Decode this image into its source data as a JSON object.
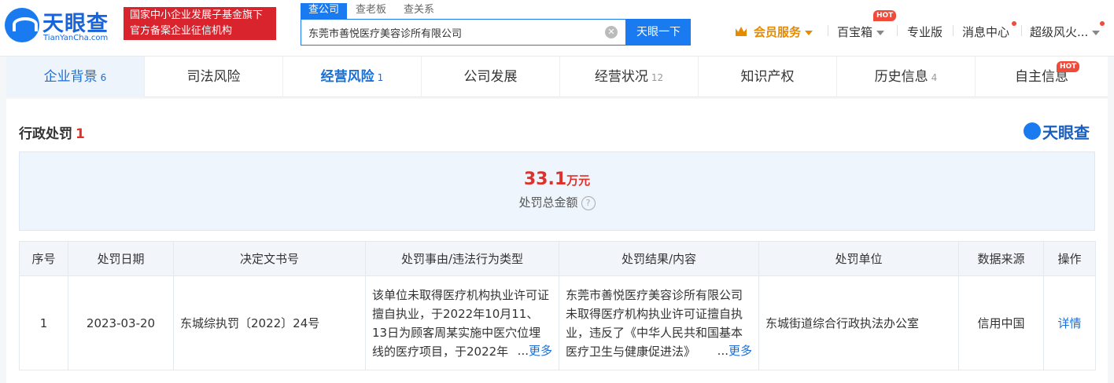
{
  "header": {
    "logo_title": "天眼查",
    "logo_sub": "TianYanCha.com",
    "banner_line1": "国家中小企业发展子基金旗下",
    "banner_line2": "官方备案企业征信机构",
    "search_tabs": [
      "查公司",
      "查老板",
      "查关系"
    ],
    "search_value": "东莞市善悦医疗美容诊所有限公司",
    "search_button": "天眼一下",
    "nav": {
      "vip": "会员服务",
      "treasure": "百宝箱",
      "hot_badge": "HOT",
      "pro": "专业版",
      "messages": "消息中心",
      "user": "超级风火..."
    }
  },
  "tabs": [
    {
      "label": "企业背景",
      "count": "6"
    },
    {
      "label": "司法风险",
      "count": ""
    },
    {
      "label": "经营风险",
      "count": "1"
    },
    {
      "label": "公司发展",
      "count": ""
    },
    {
      "label": "经营状况",
      "count": "12"
    },
    {
      "label": "知识产权",
      "count": ""
    },
    {
      "label": "历史信息",
      "count": "4"
    },
    {
      "label": "自主信息",
      "count": ""
    }
  ],
  "tab_hot_badge": "HOT",
  "section": {
    "title": "行政处罚",
    "count": "1",
    "watermark": "天眼查"
  },
  "summary": {
    "value": "33.1",
    "unit": "万元",
    "label": "处罚总金额",
    "help": "?"
  },
  "table": {
    "headers": [
      "序号",
      "处罚日期",
      "决定文书号",
      "处罚事由/违法行为类型",
      "处罚结果/内容",
      "处罚单位",
      "数据来源",
      "操作"
    ],
    "rows": [
      {
        "index": "1",
        "date": "2023-03-20",
        "doc_no": "东城综执罚〔2022〕24号",
        "reason": "该单位未取得医疗机构执业许可证擅自执业，于2022年10月11、13日为顾客周某实施中医穴位埋线的医疗项目，于2022年",
        "result": "东莞市善悦医疗美容诊所有限公司未取得医疗机构执业许可证擅自执业，违反了《中华人民共和国基本医疗卫生与健康促进法》",
        "unit": "东城街道综合行政执法办公室",
        "source": "信用中国",
        "action": "详情"
      }
    ],
    "more_label": "更多",
    "ellipsis": "..."
  }
}
